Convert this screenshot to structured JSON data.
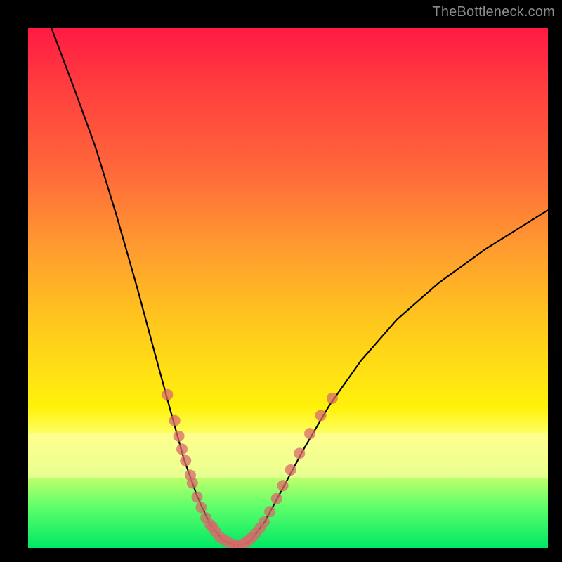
{
  "watermark": "TheBottleneck.com",
  "chart_data": {
    "type": "line",
    "title": "",
    "xlabel": "",
    "ylabel": "",
    "x_range_norm": [
      0,
      1
    ],
    "y_range_norm": [
      0,
      1
    ],
    "curve_norm": [
      {
        "x": 0.045,
        "y": 1.0
      },
      {
        "x": 0.09,
        "y": 0.88
      },
      {
        "x": 0.13,
        "y": 0.77
      },
      {
        "x": 0.17,
        "y": 0.64
      },
      {
        "x": 0.21,
        "y": 0.5
      },
      {
        "x": 0.245,
        "y": 0.37
      },
      {
        "x": 0.275,
        "y": 0.26
      },
      {
        "x": 0.3,
        "y": 0.17
      },
      {
        "x": 0.325,
        "y": 0.1
      },
      {
        "x": 0.35,
        "y": 0.045
      },
      {
        "x": 0.375,
        "y": 0.015
      },
      {
        "x": 0.4,
        "y": 0.004
      },
      {
        "x": 0.425,
        "y": 0.01
      },
      {
        "x": 0.455,
        "y": 0.05
      },
      {
        "x": 0.49,
        "y": 0.115
      },
      {
        "x": 0.53,
        "y": 0.19
      },
      {
        "x": 0.58,
        "y": 0.275
      },
      {
        "x": 0.64,
        "y": 0.36
      },
      {
        "x": 0.71,
        "y": 0.44
      },
      {
        "x": 0.79,
        "y": 0.51
      },
      {
        "x": 0.88,
        "y": 0.575
      },
      {
        "x": 1.0,
        "y": 0.65
      }
    ],
    "markers_norm": [
      {
        "x": 0.268,
        "y": 0.295
      },
      {
        "x": 0.282,
        "y": 0.245
      },
      {
        "x": 0.29,
        "y": 0.215
      },
      {
        "x": 0.296,
        "y": 0.19
      },
      {
        "x": 0.303,
        "y": 0.168
      },
      {
        "x": 0.312,
        "y": 0.14
      },
      {
        "x": 0.316,
        "y": 0.125
      },
      {
        "x": 0.325,
        "y": 0.098
      },
      {
        "x": 0.333,
        "y": 0.078
      },
      {
        "x": 0.342,
        "y": 0.058
      },
      {
        "x": 0.35,
        "y": 0.045
      },
      {
        "x": 0.355,
        "y": 0.04
      },
      {
        "x": 0.36,
        "y": 0.032
      },
      {
        "x": 0.368,
        "y": 0.022
      },
      {
        "x": 0.376,
        "y": 0.016
      },
      {
        "x": 0.384,
        "y": 0.012
      },
      {
        "x": 0.392,
        "y": 0.007
      },
      {
        "x": 0.4,
        "y": 0.006
      },
      {
        "x": 0.408,
        "y": 0.006
      },
      {
        "x": 0.416,
        "y": 0.009
      },
      {
        "x": 0.423,
        "y": 0.014
      },
      {
        "x": 0.43,
        "y": 0.02
      },
      {
        "x": 0.438,
        "y": 0.028
      },
      {
        "x": 0.446,
        "y": 0.038
      },
      {
        "x": 0.454,
        "y": 0.05
      },
      {
        "x": 0.465,
        "y": 0.07
      },
      {
        "x": 0.478,
        "y": 0.095
      },
      {
        "x": 0.49,
        "y": 0.12
      },
      {
        "x": 0.505,
        "y": 0.15
      },
      {
        "x": 0.522,
        "y": 0.182
      },
      {
        "x": 0.542,
        "y": 0.22
      },
      {
        "x": 0.563,
        "y": 0.255
      },
      {
        "x": 0.585,
        "y": 0.288
      }
    ],
    "colors": {
      "curve": "#000000",
      "markers": "#d86a6a",
      "gradient_top": "#ff1a44",
      "gradient_bottom": "#00e865"
    }
  }
}
